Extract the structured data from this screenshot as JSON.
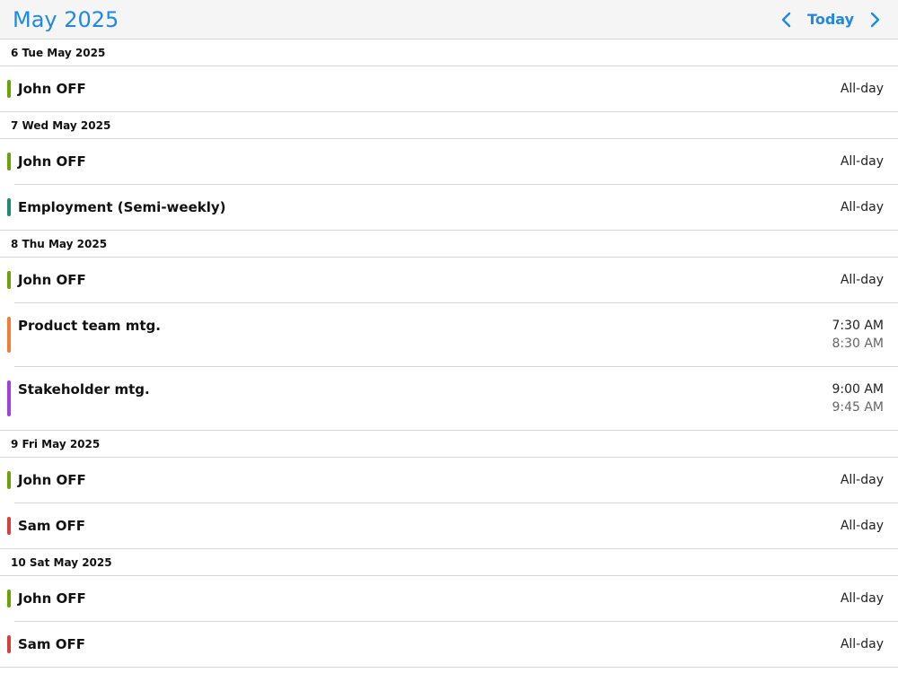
{
  "header": {
    "title": "May 2025",
    "today_label": "Today",
    "prev_icon": "chevron-left-icon",
    "next_icon": "chevron-right-icon",
    "accent_color": "#1e88e5"
  },
  "days": [
    {
      "label": "6 Tue May 2025",
      "events": [
        {
          "title": "John OFF",
          "time": "All-day",
          "color": "#6aa309"
        }
      ]
    },
    {
      "label": "7 Wed May 2025",
      "events": [
        {
          "title": "John OFF",
          "time": "All-day",
          "color": "#6aa309"
        },
        {
          "title": "Employment (Semi-weekly)",
          "time": "All-day",
          "color": "#1f8a70"
        }
      ]
    },
    {
      "label": "8 Thu May 2025",
      "events": [
        {
          "title": "John OFF",
          "time": "All-day",
          "color": "#6aa309"
        },
        {
          "title": "Product team mtg.",
          "start": "7:30 AM",
          "end": "8:30 AM",
          "color": "#f07c3a"
        },
        {
          "title": "Stakeholder mtg.",
          "start": "9:00 AM",
          "end": "9:45 AM",
          "color": "#a23fe0"
        }
      ]
    },
    {
      "label": "9 Fri May 2025",
      "events": [
        {
          "title": "John OFF",
          "time": "All-day",
          "color": "#6aa309"
        },
        {
          "title": "Sam OFF",
          "time": "All-day",
          "color": "#d0423c"
        }
      ]
    },
    {
      "label": "10 Sat May 2025",
      "events": [
        {
          "title": "John OFF",
          "time": "All-day",
          "color": "#6aa309"
        },
        {
          "title": "Sam OFF",
          "time": "All-day",
          "color": "#d0423c"
        }
      ]
    }
  ]
}
